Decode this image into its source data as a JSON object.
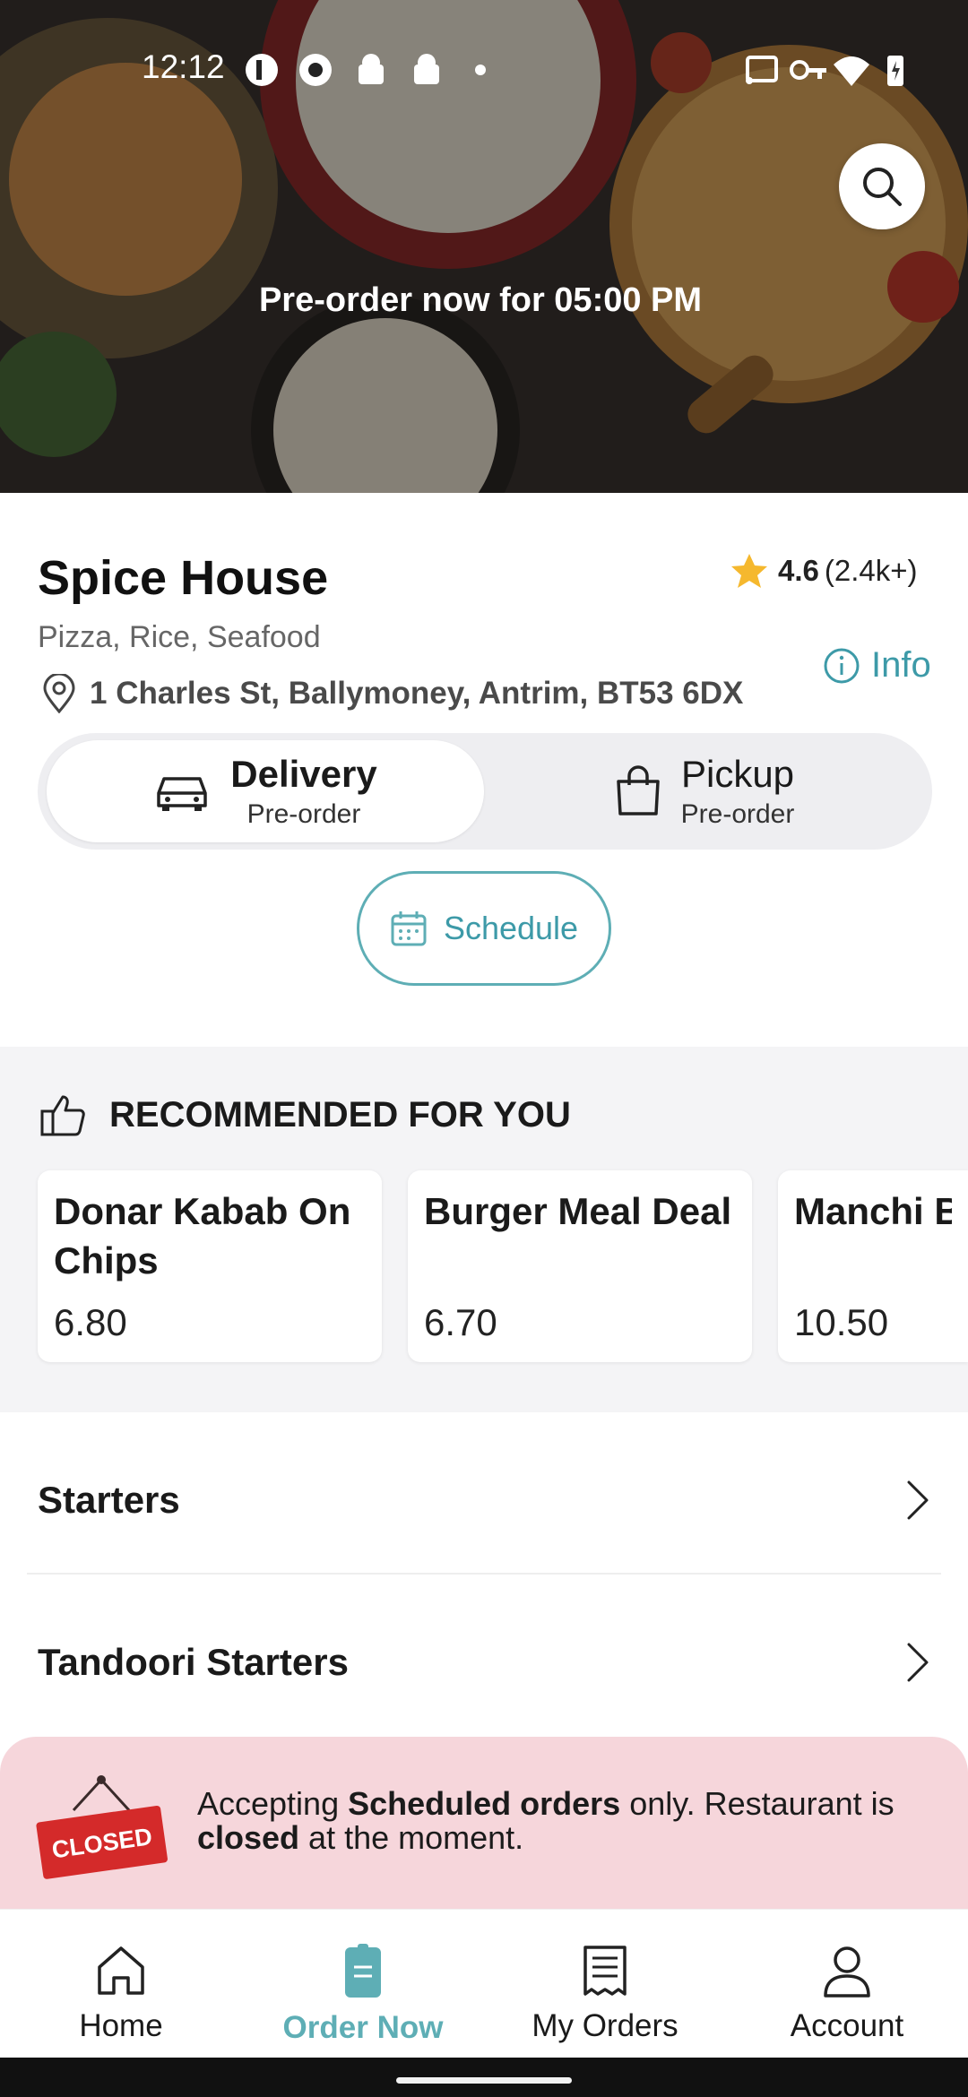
{
  "status_bar": {
    "time": "12:12"
  },
  "hero": {
    "preorder_text": "Pre-order now for 05:00 PM"
  },
  "restaurant": {
    "name": "Spice House",
    "rating": "4.6",
    "rating_count": "(2.4k+)",
    "cuisines": "Pizza, Rice, Seafood",
    "address": "1 Charles St, Ballymoney, Antrim, BT53 6DX",
    "info_label": "Info"
  },
  "order_modes": [
    {
      "label": "Delivery",
      "sub": "Pre-order",
      "selected": true
    },
    {
      "label": "Pickup",
      "sub": "Pre-order",
      "selected": false
    }
  ],
  "schedule_label": "Schedule",
  "recommended": {
    "title": "RECOMMENDED FOR YOU",
    "items": [
      {
        "name": "Donar Kabab On Chips",
        "price": "6.80"
      },
      {
        "name": "Burger Meal Deal",
        "price": "6.70"
      },
      {
        "name": "Manchi B",
        "price": "10.50"
      }
    ]
  },
  "categories": [
    {
      "label": "Starters"
    },
    {
      "label": "Tandoori Starters"
    }
  ],
  "closed_banner": {
    "sign_text": "CLOSED",
    "msg_1": "Accepting ",
    "msg_bold_1": "Scheduled orders",
    "msg_2": " only. Restaurant is ",
    "msg_bold_2": "closed",
    "msg_3": " at the moment."
  },
  "nav": [
    {
      "label": "Home",
      "icon": "home-icon",
      "active": false
    },
    {
      "label": "Order Now",
      "icon": "order-icon",
      "active": true
    },
    {
      "label": "My Orders",
      "icon": "receipt-icon",
      "active": false
    },
    {
      "label": "Account",
      "icon": "user-icon",
      "active": false
    }
  ],
  "colors": {
    "accent": "#5eaeb5",
    "closed_bg": "#f6d6db",
    "star": "#f5b82e"
  }
}
